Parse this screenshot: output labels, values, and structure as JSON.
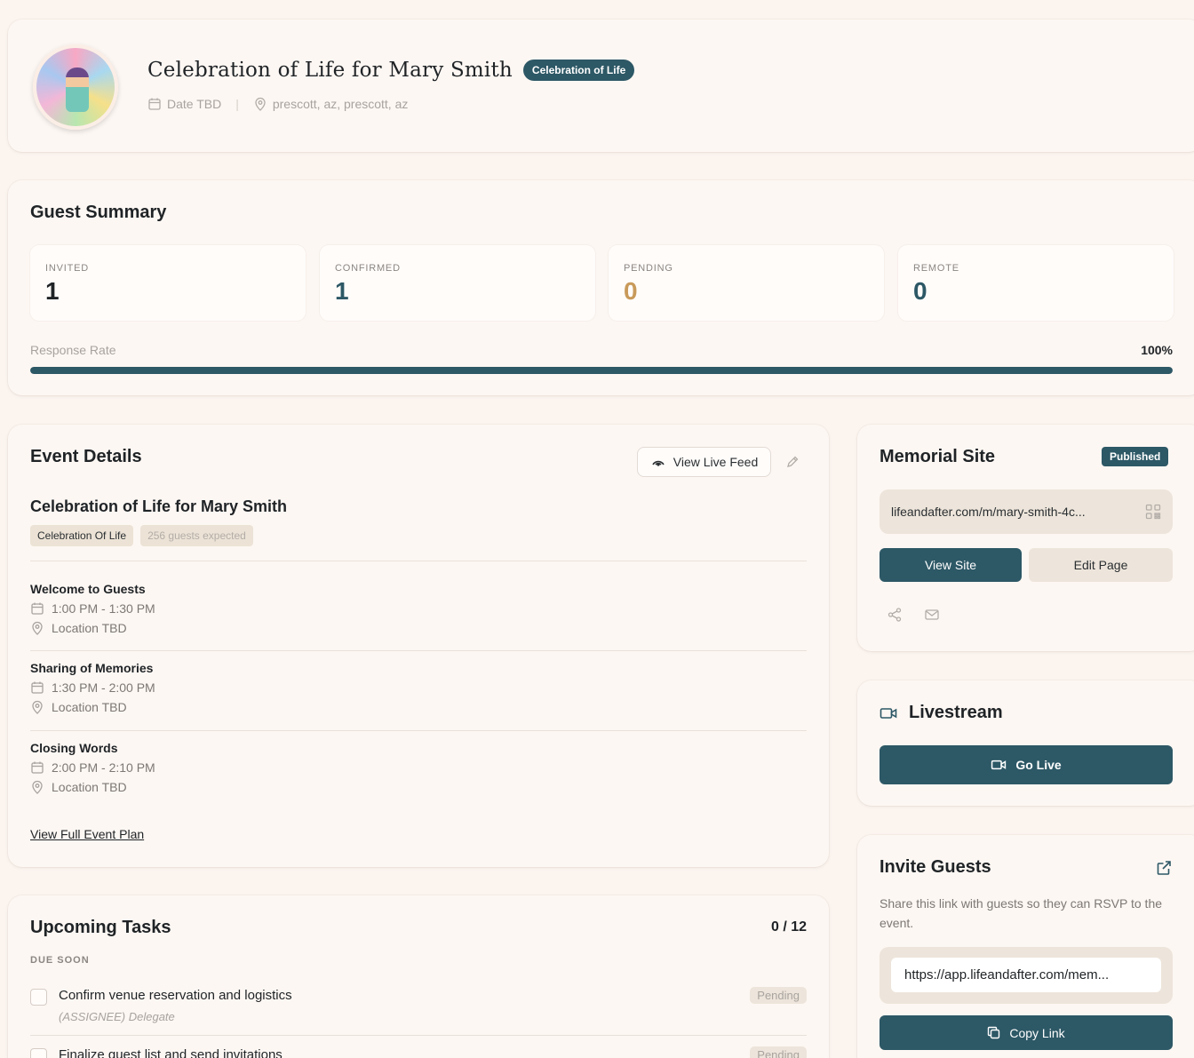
{
  "header": {
    "title": "Celebration of Life for Mary Smith",
    "type_badge": "Celebration of Life",
    "date": "Date TBD",
    "location": "prescott, az, prescott, az"
  },
  "guest_summary": {
    "title": "Guest Summary",
    "stats": [
      {
        "label": "INVITED",
        "value": "1",
        "color": "#1f2326"
      },
      {
        "label": "CONFIRMED",
        "value": "1",
        "color": "#2d5866"
      },
      {
        "label": "PENDING",
        "value": "0",
        "color": "#c89a5a"
      },
      {
        "label": "REMOTE",
        "value": "0",
        "color": "#2d5866"
      }
    ],
    "response_rate_label": "Response Rate",
    "response_rate_value": "100%",
    "response_rate_fraction": 1.0
  },
  "event_details": {
    "title": "Event Details",
    "live_feed_button": "View Live Feed",
    "event_name": "Celebration of Life for Mary Smith",
    "type_tag": "Celebration Of Life",
    "guests_tag": "256 guests expected",
    "activities": [
      {
        "name": "Welcome to Guests",
        "time": "1:00 PM - 1:30 PM",
        "location": "Location TBD"
      },
      {
        "name": "Sharing of Memories",
        "time": "1:30 PM - 2:00 PM",
        "location": "Location TBD"
      },
      {
        "name": "Closing Words",
        "time": "2:00 PM - 2:10 PM",
        "location": "Location TBD"
      }
    ],
    "full_plan_link": "View Full Event Plan"
  },
  "memorial_site": {
    "title": "Memorial Site",
    "status": "Published",
    "url": "lifeandafter.com/m/mary-smith-4c...",
    "view_button": "View Site",
    "edit_button": "Edit Page"
  },
  "livestream": {
    "title": "Livestream",
    "go_live_button": "Go Live"
  },
  "invite_guests": {
    "title": "Invite Guests",
    "description": "Share this link with guests so they can RSVP to the event.",
    "link": "https://app.lifeandafter.com/mem...",
    "copy_button": "Copy Link"
  },
  "tasks": {
    "title": "Upcoming Tasks",
    "count": "0 / 12",
    "group_label": "DUE SOON",
    "items": [
      {
        "name": "Confirm venue reservation and logistics",
        "assignee": "(ASSIGNEE) Delegate",
        "status": "Pending"
      },
      {
        "name": "Finalize guest list and send invitations",
        "assignee": "",
        "status": "Pending"
      }
    ]
  },
  "colors": {
    "accent": "#2d5866",
    "background": "#fbf4ef",
    "card": "#fdf7f3",
    "pending": "#c89a5a"
  }
}
